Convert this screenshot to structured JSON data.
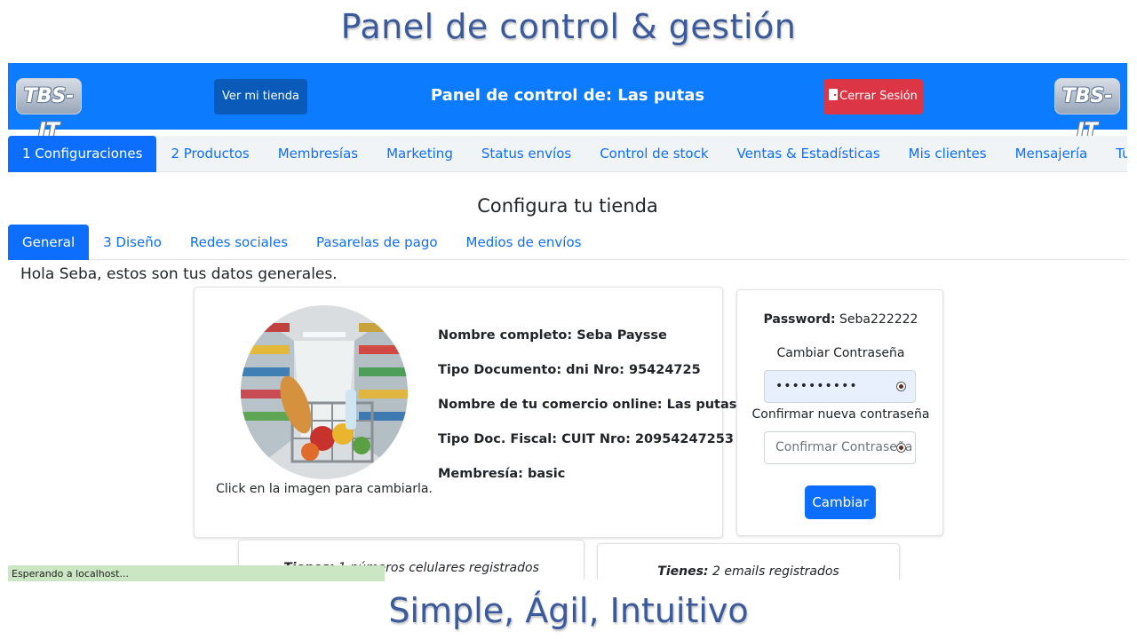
{
  "slide": {
    "title": "Panel de control & gestión",
    "subtitle": "Simple, Ágil, Intuitivo"
  },
  "header": {
    "logo_text": "TBS-IT",
    "store_button": "Ver mi tienda",
    "panel_title": "Panel de control de: Las putas",
    "logout_button": "Cerrar Sesión",
    "bar_color": "#0d7bfe"
  },
  "main_nav": {
    "items": [
      {
        "label": "1 Configuraciones",
        "active": true
      },
      {
        "label": "2 Productos"
      },
      {
        "label": "Membresías"
      },
      {
        "label": "Marketing"
      },
      {
        "label": "Status envíos"
      },
      {
        "label": "Control de stock"
      },
      {
        "label": "Ventas & Estadísticas"
      },
      {
        "label": "Mis clientes"
      },
      {
        "label": "Mensajería"
      },
      {
        "label": "Tus finanzas"
      }
    ]
  },
  "section_title": "Configura tu tienda",
  "sub_nav": {
    "items": [
      {
        "label": "General",
        "active": true
      },
      {
        "label": "3 Diseño"
      },
      {
        "label": "Redes sociales"
      },
      {
        "label": "Pasarelas de pago"
      },
      {
        "label": "Medios de envíos"
      }
    ]
  },
  "greeting": "Hola Seba, estos son tus datos generales.",
  "profile": {
    "image_hint": "Click en la imagen para cambiarla.",
    "full_name": "Nombre completo: Seba Paysse",
    "document": "Tipo Documento: dni Nro: 95424725",
    "store_name": "Nombre de tu comercio online: Las putas",
    "fiscal": "Tipo Doc. Fiscal: CUIT Nro: 20954247253",
    "membership": "Membresía: basic"
  },
  "password": {
    "label": "Password:",
    "value": "Seba222222",
    "change_label": "Cambiar Contraseña",
    "new_value": "••••••••••",
    "confirm_label": "Confirmar nueva contraseña",
    "confirm_placeholder": "Confirmar Contraseña",
    "submit": "Cambiar"
  },
  "phones": {
    "prefix": "Tienes:",
    "text": "1 números celulares registrados"
  },
  "emails": {
    "prefix": "Tienes:",
    "text": "2 emails registrados"
  },
  "status_bar": "Esperando a localhost..."
}
